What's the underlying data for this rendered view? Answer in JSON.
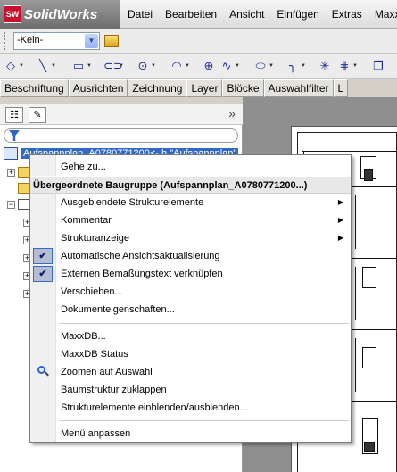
{
  "app": {
    "logo_mark": "SW",
    "name": "SolidWorks",
    "menu": [
      "Datei",
      "Bearbeiten",
      "Ansicht",
      "Einfügen",
      "Extras",
      "MaxxDB"
    ]
  },
  "configuration": {
    "selected": "-Kein-"
  },
  "sketch_toolbar": {
    "tools": [
      "dimension-icon",
      "line-icon",
      "rectangle-icon",
      "slot-icon",
      "circle-icon",
      "arc-icon",
      "polygon-icon",
      "spline-icon",
      "ellipse-icon",
      "fillet-icon",
      "point-icon",
      "construction-icon",
      "copy-icon"
    ]
  },
  "command_tabs": [
    "Beschriftung",
    "Ausrichten",
    "Zeichnung",
    "Layer",
    "Blöcke",
    "Auswahlfilter",
    "L"
  ],
  "feature_manager": {
    "more_label": "»",
    "root_label": "Aufspannplan_A0780771200<- h \"Aufspannplan\"",
    "expand_plus": "+",
    "expand_minus": "−"
  },
  "context_menu": {
    "items": [
      {
        "label": "Gehe zu..."
      },
      {
        "label": "Übergeordnete Baugruppe (Aufspannplan_A0780771200...)",
        "header": true
      },
      {
        "label": "Ausgeblendete Strukturelemente",
        "submenu": true
      },
      {
        "label": "Kommentar",
        "submenu": true
      },
      {
        "label": "Strukturanzeige",
        "submenu": true
      },
      {
        "label": "Automatische Ansichtsaktualisierung",
        "checked": true
      },
      {
        "label": "Externen Bemaßungstext verknüpfen",
        "checked": true
      },
      {
        "label": "Verschieben..."
      },
      {
        "label": "Dokumenteigenschaften..."
      },
      {
        "label": "MaxxDB..."
      },
      {
        "label": "MaxxDB Status"
      },
      {
        "label": "Zoomen auf Auswahl",
        "icon": "zoom-icon"
      },
      {
        "label": "Baumstruktur zuklappen"
      },
      {
        "label": "Strukturelemente einblenden/ausblenden..."
      },
      {
        "label": "Menü anpassen"
      }
    ],
    "check_glyph": "✔",
    "submenu_glyph": "▶"
  }
}
